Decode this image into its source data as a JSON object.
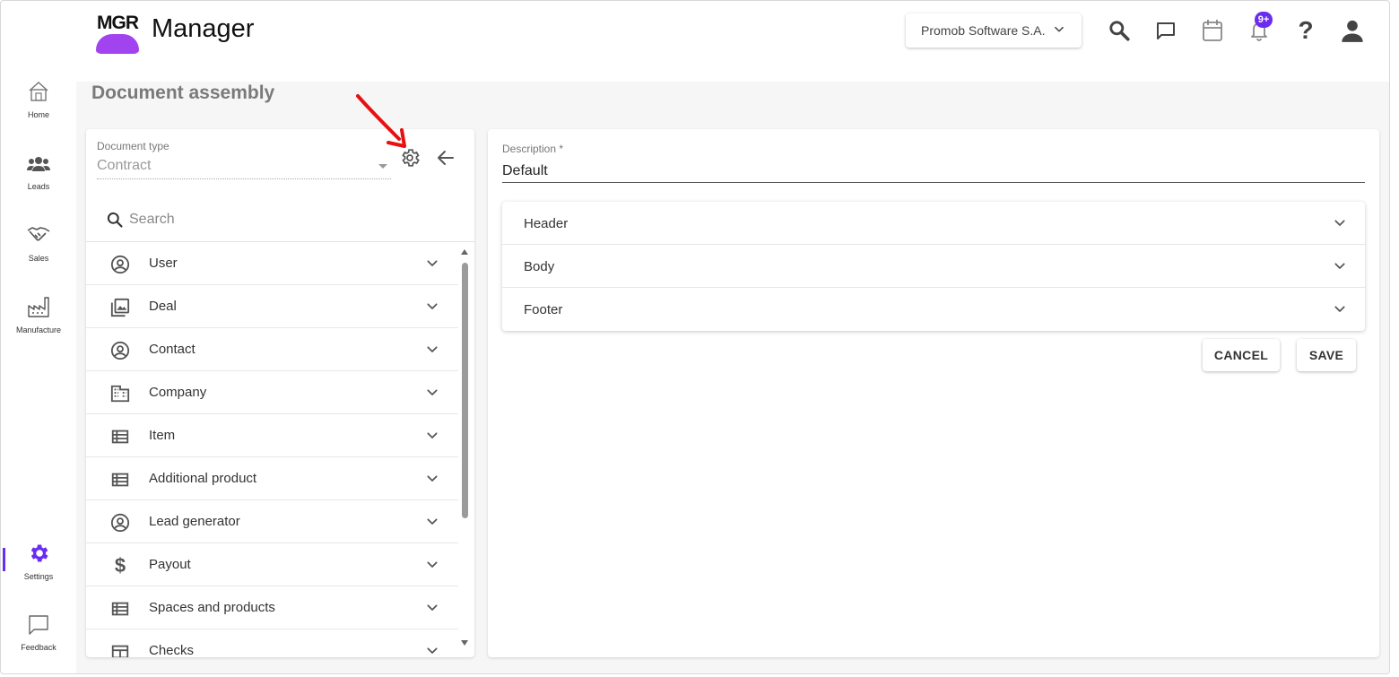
{
  "app": {
    "logo_text": "MGR",
    "name": "Manager",
    "brand_color": "#a243f0",
    "accent_color": "#6a2cf0"
  },
  "header": {
    "company": "Promob Software S.A.",
    "notification_badge": "9+",
    "icons": [
      "search-icon",
      "chat-icon",
      "calendar-icon",
      "bell-icon",
      "help-icon",
      "account-icon"
    ]
  },
  "sidebar": {
    "items": [
      {
        "label": "Home",
        "icon": "home-icon"
      },
      {
        "label": "Leads",
        "icon": "people-icon"
      },
      {
        "label": "Sales",
        "icon": "handshake-icon"
      },
      {
        "label": "Manufacture",
        "icon": "factory-icon"
      },
      {
        "label": "Settings",
        "icon": "gear-icon",
        "active": true
      },
      {
        "label": "Feedback",
        "icon": "feedback-icon"
      }
    ]
  },
  "page": {
    "title": "Document assembly"
  },
  "left_panel": {
    "doc_type_label": "Document type",
    "doc_type_value": "Contract",
    "search_placeholder": "Search",
    "items": [
      {
        "label": "User",
        "icon": "account-circle-icon"
      },
      {
        "label": "Deal",
        "icon": "image-stack-icon"
      },
      {
        "label": "Contact",
        "icon": "account-circle-icon"
      },
      {
        "label": "Company",
        "icon": "building-icon"
      },
      {
        "label": "Item",
        "icon": "list-icon"
      },
      {
        "label": "Additional product",
        "icon": "list-icon"
      },
      {
        "label": "Lead generator",
        "icon": "account-circle-icon"
      },
      {
        "label": "Payout",
        "icon": "dollar-icon"
      },
      {
        "label": "Spaces and products",
        "icon": "list-icon"
      },
      {
        "label": "Checks",
        "icon": "table-icon"
      }
    ]
  },
  "right_panel": {
    "description_label": "Description *",
    "description_value": "Default",
    "sections": [
      {
        "label": "Header"
      },
      {
        "label": "Body"
      },
      {
        "label": "Footer"
      }
    ],
    "cancel_label": "CANCEL",
    "save_label": "SAVE"
  }
}
